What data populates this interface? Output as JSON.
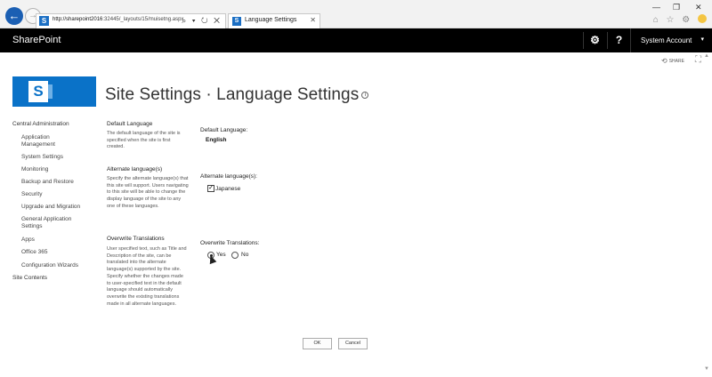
{
  "browser": {
    "url_host": "http://sharepoint2016",
    "url_path": ":32445/_layouts/15/muisetng.aspx",
    "address_tools": "⌕ ▾ ↻ ✕",
    "tab_title": "Language Settings",
    "tab_close": "✕",
    "back_icon": "←",
    "forward_icon": "→",
    "window_minimize": "—",
    "window_restore": "❐",
    "window_close": "✕",
    "right_icons": "⌂ ☆ ⚙"
  },
  "suitebar": {
    "brand": "SharePoint",
    "settings_icon": "⚙",
    "help_icon": "?",
    "account_label": "System Account",
    "account_caret": "▾"
  },
  "share": {
    "icon": "⟲",
    "label": "SHARE",
    "focus_icon": "⛶"
  },
  "logo": {
    "letter": "S"
  },
  "page": {
    "title": "Site Settings · Language Settings",
    "info_icon": "i"
  },
  "quick_launch": [
    {
      "label": "Central Administration",
      "level": "top"
    },
    {
      "label": "Application",
      "level": "sub"
    },
    {
      "label": "Management",
      "level": "sub-cont"
    },
    {
      "label": "System Settings",
      "level": "sub"
    },
    {
      "label": "Monitoring",
      "level": "sub"
    },
    {
      "label": "Backup and Restore",
      "level": "sub"
    },
    {
      "label": "Security",
      "level": "sub"
    },
    {
      "label": "Upgrade and Migration",
      "level": "sub"
    },
    {
      "label": "General Application",
      "level": "sub"
    },
    {
      "label": "Settings",
      "level": "sub-cont"
    },
    {
      "label": "Apps",
      "level": "sub"
    },
    {
      "label": "Office 365",
      "level": "sub"
    },
    {
      "label": "Configuration Wizards",
      "level": "sub"
    },
    {
      "label": "Site Contents",
      "level": "top"
    }
  ],
  "sections": {
    "default_language": {
      "title": "Default Language",
      "description": "The default language of the site is specified when the site is first created.",
      "field_label": "Default Language:",
      "value": "English"
    },
    "alternate_languages": {
      "title": "Alternate language(s)",
      "description": "Specify the alternate language(s) that this site will support. Users navigating to this site will be able to change the display language of the site to any one of these languages.",
      "field_label": "Alternate language(s):",
      "checkbox_label": "Japanese",
      "checkbox_mark": "✓",
      "checked": true
    },
    "overwrite_translations": {
      "title": "Overwrite Translations",
      "description": "User specified text, such as Title and Description of the site, can be translated into the alternate language(s) supported by the site. Specify whether the changes made to user-specified text in the default language should automatically overwrite the existing translations made in all alternate languages.",
      "field_label": "Overwrite Translations:",
      "option_yes": "Yes",
      "option_no": "No",
      "selected": "Yes"
    }
  },
  "buttons": {
    "ok": "OK",
    "cancel": "Cancel"
  },
  "colors": {
    "suitebar": "#000000",
    "brand_blue": "#0a72c8",
    "browser_back": "#1b5fb3"
  }
}
